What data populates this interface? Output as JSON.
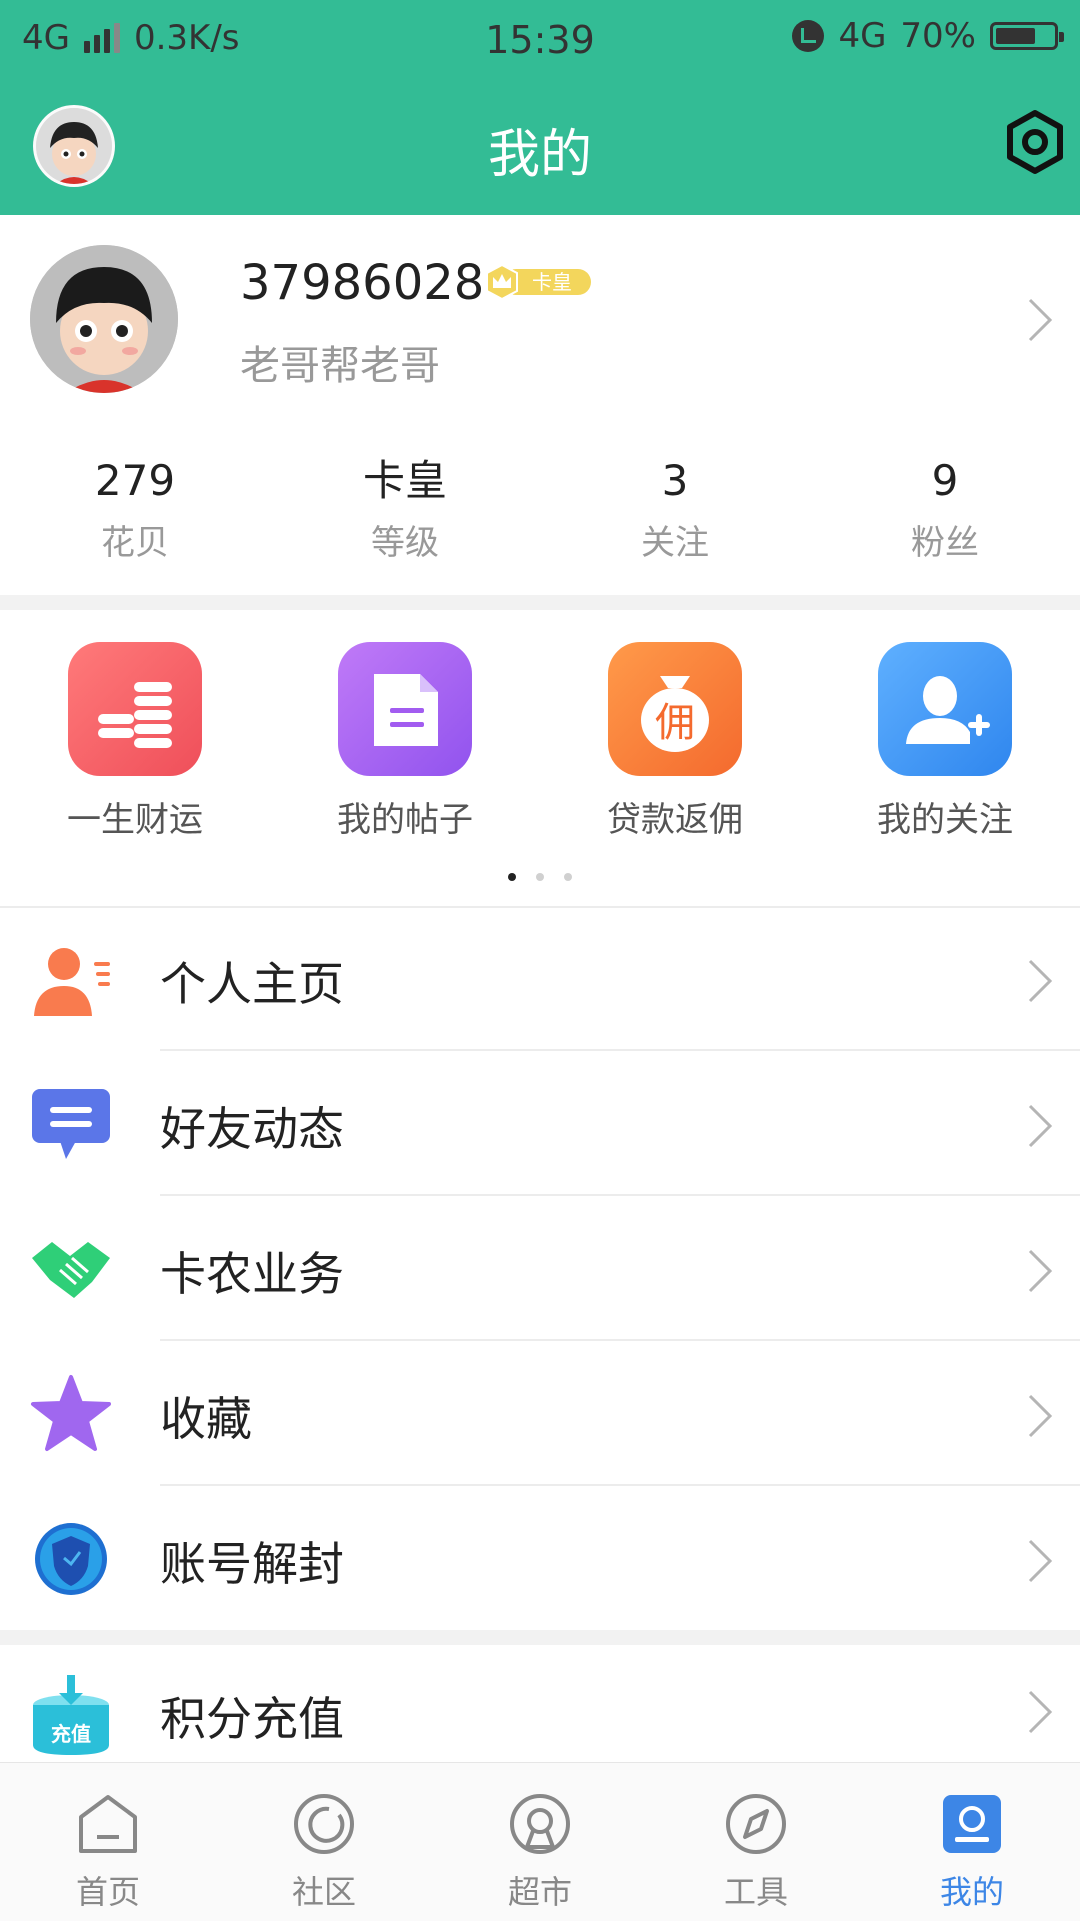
{
  "status_bar": {
    "network_left": "4G",
    "speed": "0.3K/s",
    "time": "15:39",
    "network_right": "4G",
    "battery": "70%",
    "battery_level": 0.7
  },
  "header": {
    "title": "我的"
  },
  "profile": {
    "user_id": "37986028",
    "badge": "卡皇",
    "nickname": "老哥帮老哥"
  },
  "stats": [
    {
      "value": "279",
      "label": "花贝"
    },
    {
      "value": "卡皇",
      "label": "等级"
    },
    {
      "value": "3",
      "label": "关注"
    },
    {
      "value": "9",
      "label": "粉丝"
    }
  ],
  "quick_actions": [
    {
      "label": "一生财运",
      "icon": "coins-icon",
      "color": "#f4656b"
    },
    {
      "label": "我的帖子",
      "icon": "document-icon",
      "color": "#a25cf0"
    },
    {
      "label": "贷款返佣",
      "icon": "money-bag-icon",
      "color": "#f87a3a",
      "glyph": "佣"
    },
    {
      "label": "我的关注",
      "icon": "add-user-icon",
      "color": "#3d8ff0"
    }
  ],
  "pager": {
    "pages": 3,
    "active": 1
  },
  "menu": [
    {
      "label": "个人主页",
      "icon": "profile-icon"
    },
    {
      "label": "好友动态",
      "icon": "chat-bubble-icon"
    },
    {
      "label": "卡农业务",
      "icon": "handshake-icon"
    },
    {
      "label": "收藏",
      "icon": "star-icon"
    },
    {
      "label": "账号解封",
      "icon": "shield-icon"
    },
    {
      "label": "积分充值",
      "icon": "recharge-icon",
      "icon_text": "充值"
    }
  ],
  "tabs": [
    {
      "label": "首页",
      "icon": "home-icon"
    },
    {
      "label": "社区",
      "icon": "community-icon"
    },
    {
      "label": "超市",
      "icon": "market-icon"
    },
    {
      "label": "工具",
      "icon": "compass-icon"
    },
    {
      "label": "我的",
      "icon": "me-icon",
      "active": true
    }
  ],
  "colors": {
    "primary": "#33bc95",
    "tab_active": "#3d86e6"
  }
}
